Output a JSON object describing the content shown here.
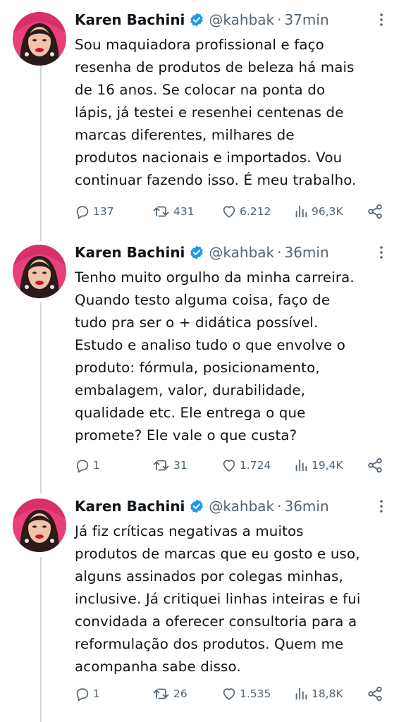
{
  "tweets": [
    {
      "author": "Karen Bachini",
      "handle": "@kahbak",
      "separator": "·",
      "time": "37min",
      "lines": [
        "Sou maquiadora profissional e faço",
        "resenha de produtos de beleza há mais",
        "de 16 anos. Se colocar na ponta do",
        "lápis, já testei e resenhei centenas de",
        "marcas diferentes, milhares de",
        "produtos nacionais e importados. Vou",
        "continuar fazendo isso. É meu trabalho."
      ],
      "replies": "137",
      "retweets": "431",
      "likes": "6.212",
      "views": "96,3K"
    },
    {
      "author": "Karen Bachini",
      "handle": "@kahbak",
      "separator": "·",
      "time": "36min",
      "lines": [
        "Tenho muito orgulho da minha carreira.",
        "Quando testo alguma coisa, faço de",
        "tudo pra ser o + didática possível.",
        "Estudo e analiso tudo o que envolve o",
        "produto: fórmula, posicionamento,",
        "embalagem, valor, durabilidade,",
        "qualidade etc. Ele entrega o que",
        "promete? Ele vale o que custa?"
      ],
      "replies": "1",
      "retweets": "31",
      "likes": "1.724",
      "views": "19,4K"
    },
    {
      "author": "Karen Bachini",
      "handle": "@kahbak",
      "separator": "·",
      "time": "36min",
      "lines": [
        "Já fiz críticas negativas a muitos",
        "produtos de marcas que eu gosto e uso,",
        "alguns assinados por colegas minhas,",
        "inclusive. Já critiquei linhas inteiras e fui",
        "convidada a oferecer consultoria para a",
        "reformulação dos produtos. Quem me",
        "acompanha sabe disso."
      ],
      "replies": "1",
      "retweets": "26",
      "likes": "1.535",
      "views": "18,8K"
    }
  ],
  "colors": {
    "text": "#0f1419",
    "secondary": "#536471",
    "verified": "#1d9bf0",
    "thread_line": "#cfd9de"
  },
  "icons": [
    "verified-badge-icon",
    "more-options-icon",
    "reply-icon",
    "retweet-icon",
    "like-icon",
    "views-icon",
    "share-icon"
  ]
}
